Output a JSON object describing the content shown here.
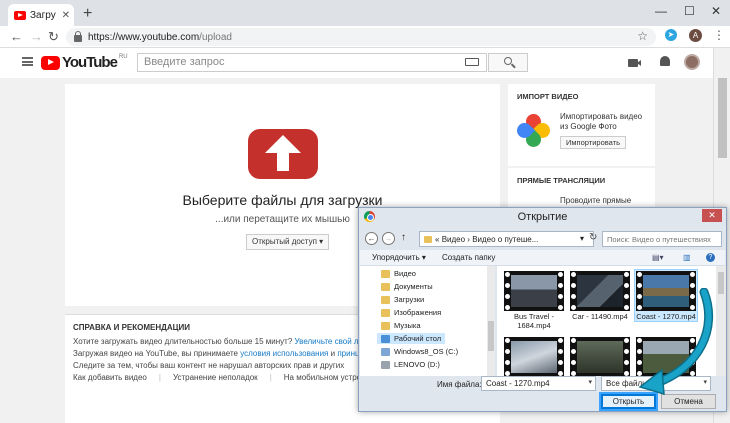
{
  "browser": {
    "tab_title": "Загру",
    "url_domain": "https://www.youtube.com",
    "url_path": "/upload",
    "profile_initial": "A"
  },
  "youtube": {
    "logo_text": "YouTube",
    "logo_region": "RU",
    "search_placeholder": "Введите запрос",
    "upload": {
      "title": "Выберите файлы для загрузки",
      "subtitle": "...или перетащите их мышью",
      "privacy_button": "Открытый доступ"
    },
    "import": {
      "title": "ИМПОРТ ВИДЕО",
      "text_line1": "Импортировать видео",
      "text_line2": "из Google Фото",
      "button": "Импортировать"
    },
    "live": {
      "title": "ПРЯМЫЕ ТРАНСЛЯЦИИ",
      "text_line1": "Проводите прямые"
    },
    "help": {
      "title": "СПРАВКА И РЕКОМЕНДАЦИИ",
      "line1_text": "Хотите загружать видео длительностью больше 15 минут?",
      "line1_link": "Увеличьте свой лимит",
      "line2_text": "Загружая видео на YouTube, вы принимаете",
      "line2_link1": "условия использования",
      "line2_and": "и",
      "line2_link2": "принципы сооб",
      "line3_text": "Следите за тем, чтобы ваш контент не нарушал авторских прав и других",
      "links": [
        "Как добавить видео",
        "Устранение неполадок",
        "На мобильном устройстве"
      ]
    }
  },
  "dialog": {
    "title": "Открытие",
    "path_prefix": "«",
    "path_part1": "Видео",
    "path_sep": "›",
    "path_part2": "Видео о путеше...",
    "search_placeholder": "Поиск: Видео о путешествиях",
    "organize": "Упорядочить ▾",
    "new_folder": "Создать папку",
    "nav_items": [
      {
        "label": "Видео",
        "color": "#e8c15a"
      },
      {
        "label": "Документы",
        "color": "#e8c15a"
      },
      {
        "label": "Загрузки",
        "color": "#e8c15a"
      },
      {
        "label": "Изображения",
        "color": "#e8c15a"
      },
      {
        "label": "Музыка",
        "color": "#e8c15a"
      },
      {
        "label": "Рабочий стол",
        "color": "#e8c15a"
      },
      {
        "label": "Windows8_OS (C:)",
        "color": "#7fa7d6"
      },
      {
        "label": "LENOVO (D:)",
        "color": "#9aa3ad"
      }
    ],
    "files": [
      {
        "name_line1": "Bus Travel -",
        "name_line2": "1684.mp4",
        "selected": false
      },
      {
        "name_line1": "Car - 11490.mp4",
        "name_line2": "",
        "selected": false
      },
      {
        "name_line1": "Coast - 1270.mp4",
        "name_line2": "",
        "selected": true
      }
    ],
    "filename_label": "Имя файла:",
    "filename_value": "Coast - 1270.mp4",
    "filetype_value": "Все файлы",
    "open_button": "Открыть",
    "cancel_button": "Отмена"
  },
  "colors": {
    "youtube_red": "#ff0000",
    "upload_red": "#c4302b",
    "link_blue": "#167ac6",
    "dialog_accent": "#0078d7",
    "callout_arrow": "#1aa3c9"
  }
}
